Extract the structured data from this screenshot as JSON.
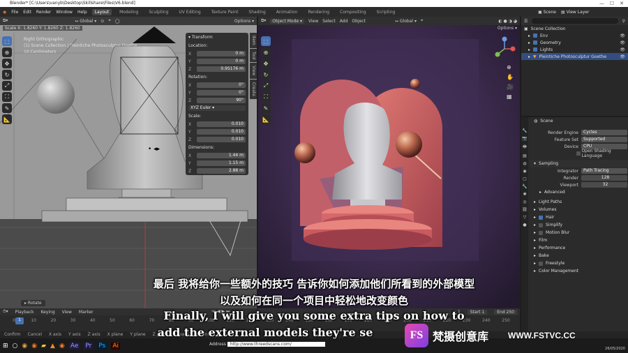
{
  "window": {
    "title": "Blender* [C:\\Users\\vanyb\\Desktop\\Skillshare\\Files\\V6.blend]"
  },
  "menu": [
    "File",
    "Edit",
    "Render",
    "Window",
    "Help"
  ],
  "workspaces": [
    "Layout",
    "Modeling",
    "Sculpting",
    "UV Editing",
    "Texture Paint",
    "Shading",
    "Animation",
    "Rendering",
    "Compositing",
    "Scripting"
  ],
  "scene_label": "Scene",
  "view_layer_label": "View Layer",
  "left_view": {
    "header": {
      "orientation": "Global",
      "options": "Options"
    },
    "scale_info": "Scale X: 1.8260   Y: 1.8260   Z: 1.8260",
    "overlay_lines": [
      "Right Orthographic",
      "(1) Scene Collection | Pleintiche Photosculptur Goethe",
      "10 Centimeters"
    ],
    "operator": "Rotate",
    "transform": {
      "title": "Transform",
      "location_label": "Location:",
      "location": [
        [
          "X",
          "0 m"
        ],
        [
          "Y",
          "0 m"
        ],
        [
          "Z",
          "0.95176 m"
        ]
      ],
      "rotation_label": "Rotation:",
      "rotation": [
        [
          "X",
          "0°"
        ],
        [
          "Y",
          "0°"
        ],
        [
          "Z",
          "90°"
        ]
      ],
      "rotation_mode": "XYZ Euler",
      "scale_label": "Scale:",
      "scale": [
        [
          "X",
          "0.010"
        ],
        [
          "Y",
          "0.010"
        ],
        [
          "Z",
          "0.010"
        ]
      ],
      "dimensions_label": "Dimensions:",
      "dimensions": [
        [
          "X",
          "1.44 m"
        ],
        [
          "Y",
          "1.15 m"
        ],
        [
          "Z",
          "2.88 m"
        ]
      ]
    },
    "side_tabs": [
      "Item",
      "Tool",
      "View",
      "Create"
    ]
  },
  "right_view": {
    "mode": "Object Mode",
    "menu": [
      "View",
      "Select",
      "Add",
      "Object"
    ],
    "orientation": "Global",
    "options": "Options"
  },
  "outliner": {
    "root": "Scene Collection",
    "items": [
      {
        "name": "Env"
      },
      {
        "name": "Geometry"
      },
      {
        "name": "Lights"
      },
      {
        "name": "Pleintiche Photosculptur Goethe"
      }
    ]
  },
  "properties": {
    "scene": "Scene",
    "render_engine": {
      "label": "Render Engine",
      "value": "Cycles"
    },
    "feature_set": {
      "label": "Feature Set",
      "value": "Supported"
    },
    "device": {
      "label": "Device",
      "value": "CPU"
    },
    "osl": "Open Shading Language",
    "sampling": "Sampling",
    "integrator": {
      "label": "Integrator",
      "value": "Path Tracing"
    },
    "render": {
      "label": "Render",
      "value": "128"
    },
    "viewport": {
      "label": "Viewport",
      "value": "32"
    },
    "advanced": "Advanced",
    "panels": [
      "Light Paths",
      "Volumes",
      "Hair",
      "Simplify",
      "Motion Blur",
      "Film",
      "Performance",
      "Bake",
      "Freestyle",
      "Color Management"
    ]
  },
  "timeline": {
    "menu": [
      "Playback",
      "Keying",
      "View",
      "Marker"
    ],
    "ticks": [
      "0",
      "10",
      "20",
      "30",
      "40",
      "50",
      "60",
      "70",
      "80",
      "90",
      "100",
      "110",
      "120",
      "130",
      "140",
      "150",
      "160",
      "170",
      "180",
      "190",
      "200",
      "210",
      "220",
      "230",
      "240",
      "250"
    ],
    "current": "1",
    "start_label": "Start",
    "start": "1",
    "end_label": "End",
    "end": "250"
  },
  "statusbar": [
    "Confirm",
    "Cancel",
    "X axis",
    "Y axis",
    "Z axis",
    "X plane",
    "Y plane",
    "Z plane",
    "Clear Constraints"
  ],
  "taskbar": {
    "address_label": "Address",
    "url": "http://www.threedscans.com/",
    "date": "26/05/2020"
  },
  "subtitles": {
    "zh1": "最后 我将给你一些额外的技巧 告诉你如何添加他们所看到的外部模型",
    "zh2": "以及如何在同一个项目中轻松地改变颜色",
    "en1": "Finally, I will give you some extra tips on how to",
    "en2": "add the external models they're se"
  },
  "watermark": {
    "logo": "FS",
    "text": "梵摄创意库",
    "url": "WWW.FSTVC.CC"
  }
}
